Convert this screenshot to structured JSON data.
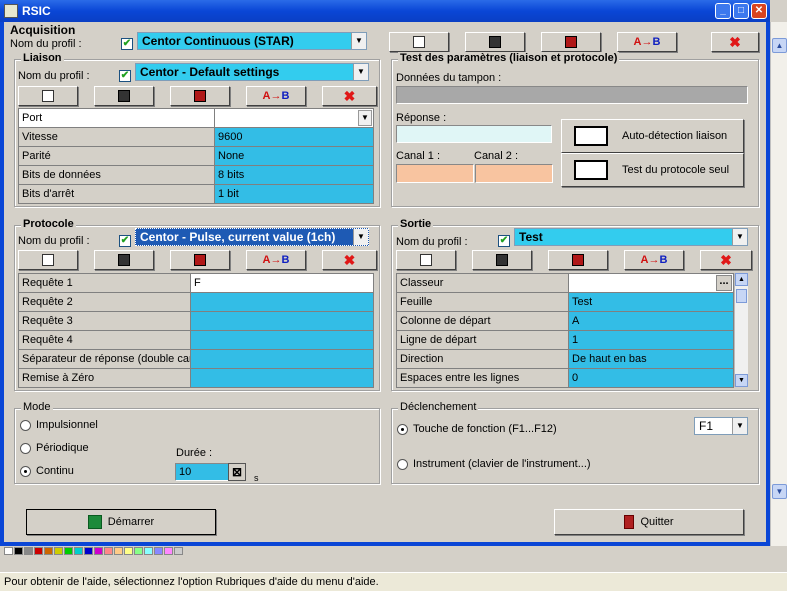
{
  "window": {
    "title": "RSIC"
  },
  "acquisition": {
    "section": "Acquisition",
    "profile_label": "Nom du profil :",
    "profile": "Centor Continuous (STAR)"
  },
  "buttons": {
    "ab": "A",
    "ab2": "B",
    "del": "✖"
  },
  "liaison": {
    "section": "Liaison",
    "profile_label": "Nom du profil :",
    "profile": "Centor - Default settings",
    "rows": [
      {
        "k": "Port",
        "v": ""
      },
      {
        "k": "Vitesse",
        "v": "9600"
      },
      {
        "k": "Parité",
        "v": "None"
      },
      {
        "k": "Bits de données",
        "v": "8 bits"
      },
      {
        "k": "Bits d'arrêt",
        "v": "1 bit"
      }
    ]
  },
  "test": {
    "section": "Test des paramètres (liaison et protocole)",
    "buffer_label": "Données du tampon :",
    "response_label": "Réponse :",
    "channel1_label": "Canal 1 :",
    "channel2_label": "Canal 2 :",
    "auto_detect": "Auto-détection liaison",
    "protocol_test": "Test du protocole seul"
  },
  "protocole": {
    "section": "Protocole",
    "profile_label": "Nom du profil :",
    "profile": "Centor - Pulse, current value (1ch)",
    "rows": [
      {
        "k": "Requête 1",
        "v": "F"
      },
      {
        "k": "Requête 2",
        "v": ""
      },
      {
        "k": "Requête 3",
        "v": ""
      },
      {
        "k": "Requête 4",
        "v": ""
      },
      {
        "k": "Séparateur de réponse (double cana",
        "v": ""
      },
      {
        "k": "Remise à Zéro",
        "v": ""
      }
    ]
  },
  "sortie": {
    "section": "Sortie",
    "profile_label": "Nom du profil :",
    "profile": "Test",
    "rows": [
      {
        "k": "Classeur",
        "v": ""
      },
      {
        "k": "Feuille",
        "v": "Test"
      },
      {
        "k": "Colonne de départ",
        "v": "A"
      },
      {
        "k": "Ligne de départ",
        "v": "1"
      },
      {
        "k": "Direction",
        "v": "De haut en bas"
      },
      {
        "k": "Espaces entre les lignes",
        "v": "0"
      }
    ],
    "browse": "..."
  },
  "mode": {
    "section": "Mode",
    "options": [
      "Impulsionnel",
      "Périodique",
      "Continu"
    ],
    "selected": "Continu",
    "duration_label": "Durée :",
    "duration": "10",
    "unit": "s"
  },
  "trigger": {
    "section": "Déclenchement",
    "fkey": "Touche de fonction (F1...F12)",
    "instrument": "Instrument (clavier de l'instrument...)",
    "key": "F1"
  },
  "footer": {
    "start": "Démarrer",
    "quit": "Quitter"
  },
  "status": "Pour obtenir de l'aide, sélectionnez l'option Rubriques d'aide du menu d'aide."
}
